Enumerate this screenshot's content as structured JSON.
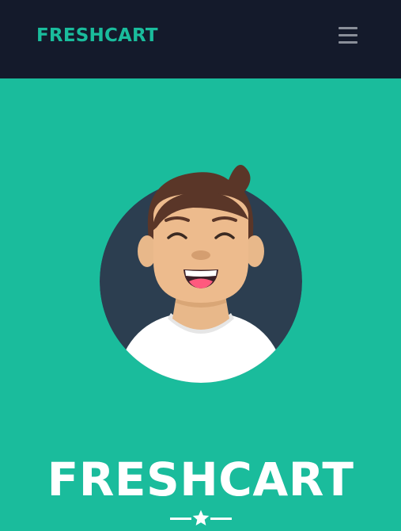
{
  "navbar": {
    "brand": "FRESHCART",
    "menu_icon": "hamburger-menu-icon"
  },
  "hero": {
    "title": "FRESHCART",
    "avatar_icon": "smiling-person-avatar",
    "divider_icon": "star-icon"
  },
  "colors": {
    "navbar_bg": "#141a2b",
    "brand": "#1abc9c",
    "hero_bg": "#1abc9c",
    "menu_icon": "#8a8f99",
    "hero_text": "#ffffff",
    "avatar_circle": "#2c3e50"
  }
}
